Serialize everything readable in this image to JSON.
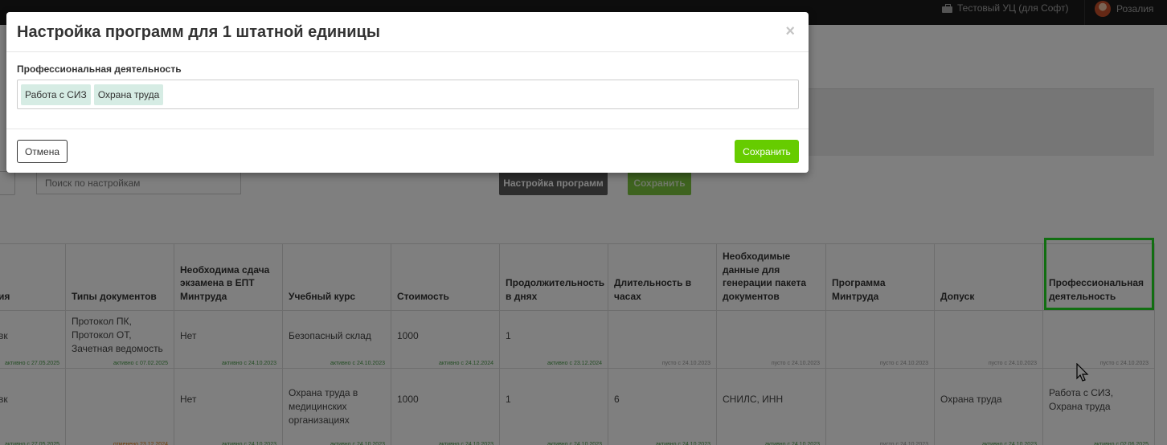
{
  "topbar": {
    "org_icon": "briefcase-icon",
    "org_name": "Тестовый УЦ (для Софт)",
    "user_name": "Розалия"
  },
  "toolbar": {
    "search_placeholder": "Поиск по настройкам",
    "programs_button": "Настройка программ",
    "save_button": "Сохранить"
  },
  "table": {
    "columns": [
      "ия",
      "Типы документов",
      "Необходима сдача экзамена в ЕПТ Минтруда",
      "Учебный курс",
      "Стоимость",
      "Продолжительность в днях",
      "Длительность в часах",
      "Необходимые данные для генерации пакета документов",
      "Программа Минтруда",
      "Допуск",
      "Профессиональная деятельность"
    ],
    "rows": [
      {
        "cells": [
          {
            "value": "вк",
            "meta": "активно с 27.05.2025",
            "status": "active"
          },
          {
            "value": "Протокол ПК, Протокол ОТ, Зачетная ведомость",
            "meta": "активно с 07.02.2025",
            "status": "active"
          },
          {
            "value": "Нет",
            "meta": "активно с 24.10.2023",
            "status": "active"
          },
          {
            "value": "Безопасный склад",
            "meta": "активно с 24.10.2023",
            "status": "active"
          },
          {
            "value": "1000",
            "meta": "активно с 24.12.2024",
            "status": "active"
          },
          {
            "value": "1",
            "meta": "активно с 23.12.2024",
            "status": "active"
          },
          {
            "value": "",
            "meta": "пусто с 24.10.2023",
            "status": "empty"
          },
          {
            "value": "",
            "meta": "пусто с 24.10.2023",
            "status": "empty"
          },
          {
            "value": "",
            "meta": "пусто с 24.10.2023",
            "status": "empty"
          },
          {
            "value": "",
            "meta": "пусто с 24.10.2023",
            "status": "empty"
          },
          {
            "value": "",
            "meta": "пусто с 24.10.2023",
            "status": "empty"
          }
        ]
      },
      {
        "cells": [
          {
            "value": "вк",
            "meta": "активно с 27.05.2025",
            "status": "active"
          },
          {
            "value": "",
            "meta": "отменено 23.12.2024",
            "status": "cancelled"
          },
          {
            "value": "Нет",
            "meta": "активно с 24.10.2023",
            "status": "active"
          },
          {
            "value": "Охрана труда в медицинских организациях",
            "meta": "активно с 24.10.2023",
            "status": "active"
          },
          {
            "value": "1000",
            "meta": "активно с 24.10.2023",
            "status": "active"
          },
          {
            "value": "1",
            "meta": "активно с 24.10.2023",
            "status": "active"
          },
          {
            "value": "6",
            "meta": "активно с 24.10.2023",
            "status": "active"
          },
          {
            "value": "СНИЛС, ИНН",
            "meta": "активно с 24.10.2023",
            "status": "active"
          },
          {
            "value": "",
            "meta": "пусто с 24.10.2023",
            "status": "empty"
          },
          {
            "value": "Охрана труда",
            "meta": "активно с 24.10.2023",
            "status": "active"
          },
          {
            "value": "Работа с СИЗ, Охрана труда",
            "meta": "активно с 02.06.2025",
            "status": "active"
          }
        ]
      }
    ]
  },
  "modal": {
    "title": "Настройка программ для 1 штатной единицы",
    "close_symbol": "×",
    "field_label": "Профессиональная деятельность",
    "tags": [
      "Работа с СИЗ",
      "Охрана труда"
    ],
    "cancel_label": "Отмена",
    "save_label": "Сохранить"
  },
  "colors": {
    "save_green": "#66cc00",
    "tag_bg": "#d6ece4",
    "highlight": "#22dd22"
  }
}
